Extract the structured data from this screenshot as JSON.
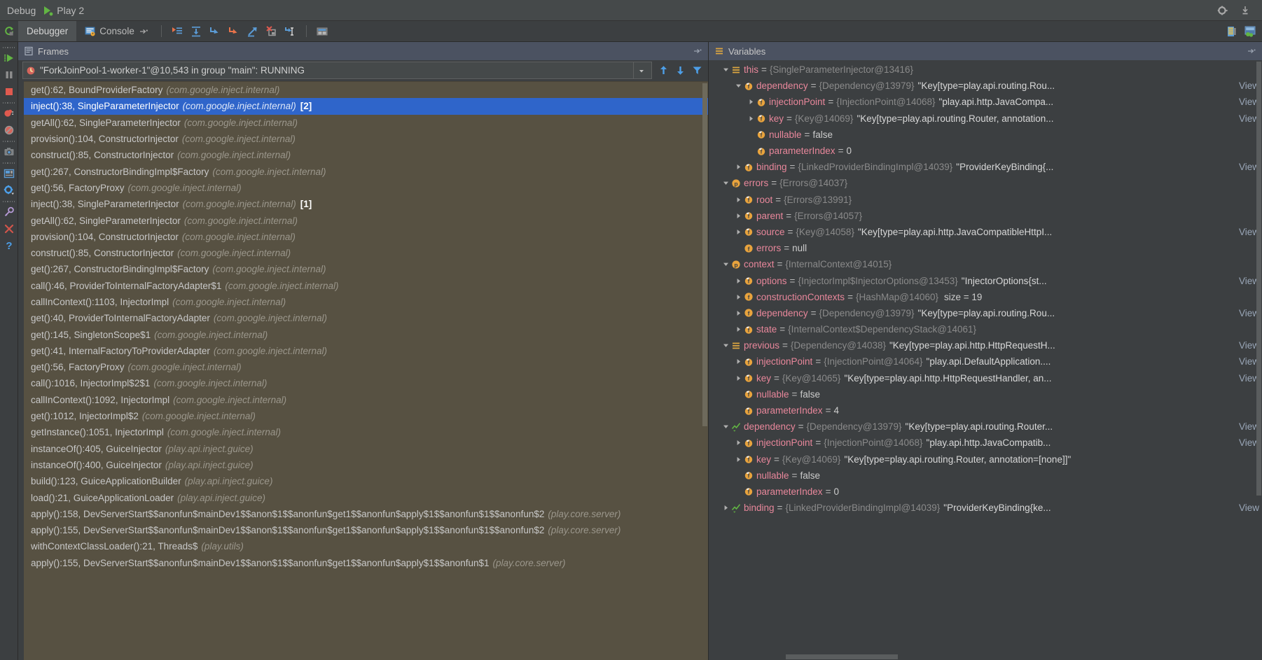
{
  "titlebar": {
    "debug_label": "Debug",
    "config_name": "Play 2",
    "settings_icon": "gear-icon",
    "minimize_icon": "minimize-icon"
  },
  "toolbar": {
    "rerun_icon": "rerun-icon",
    "tabs": [
      {
        "label": "Debugger",
        "icon": "debugger-icon",
        "active": true
      },
      {
        "label": "Console",
        "icon": "console-icon",
        "active": false
      }
    ],
    "console_pin_icon": "pin-arrow-icon",
    "buttons": [
      {
        "name": "show-execution-point",
        "icon": "execution-point-icon"
      },
      {
        "name": "step-over",
        "icon": "step-over-icon"
      },
      {
        "name": "step-into",
        "icon": "step-into-icon"
      },
      {
        "name": "force-step-into",
        "icon": "force-step-into-icon"
      },
      {
        "name": "step-out",
        "icon": "step-out-icon"
      },
      {
        "name": "drop-frame",
        "icon": "drop-frame-icon"
      },
      {
        "name": "run-to-cursor",
        "icon": "run-to-cursor-icon"
      },
      {
        "name": "evaluate-expression",
        "icon": "evaluate-expression-icon"
      }
    ],
    "right_buttons": [
      {
        "name": "threads-view",
        "icon": "threads-icon"
      },
      {
        "name": "settings-view",
        "icon": "layout-settings-icon"
      }
    ]
  },
  "rail": {
    "items": [
      {
        "name": "resume-program",
        "icon": "resume-icon"
      },
      {
        "name": "pause-program",
        "icon": "pause-icon"
      },
      {
        "name": "stop-program",
        "icon": "stop-icon"
      },
      {
        "name": "view-breakpoints",
        "icon": "breakpoints-icon"
      },
      {
        "name": "mute-breakpoints",
        "icon": "mute-breakpoints-icon"
      },
      {
        "name": "get-thread-dump",
        "icon": "camera-icon"
      },
      {
        "name": "restore-layout",
        "icon": "layout-icon"
      },
      {
        "name": "settings",
        "icon": "gear-icon"
      },
      {
        "name": "pin-tab",
        "icon": "pin-icon"
      },
      {
        "name": "close",
        "icon": "close-icon"
      },
      {
        "name": "help",
        "icon": "help-icon"
      }
    ]
  },
  "frames": {
    "panel_title": "Frames",
    "panel_icon": "frames-icon",
    "collapse_icon": "collapse-icon",
    "thread": {
      "icon": "thread-running-icon",
      "label": "\"ForkJoinPool-1-worker-1\"@10,543 in group \"main\": RUNNING",
      "dropdown_icon": "chevron-down-icon"
    },
    "tools": [
      {
        "name": "sort-frames-up",
        "icon": "arrow-up-icon"
      },
      {
        "name": "sort-frames-down",
        "icon": "arrow-down-icon"
      },
      {
        "name": "filter-frames",
        "icon": "filter-icon"
      }
    ],
    "rows": [
      {
        "method": "get():62, BoundProviderFactory",
        "pkg": "(com.google.inject.internal)",
        "count": "",
        "selected": false
      },
      {
        "method": "inject():38, SingleParameterInjector",
        "pkg": "(com.google.inject.internal)",
        "count": "[2]",
        "selected": true
      },
      {
        "method": "getAll():62, SingleParameterInjector",
        "pkg": "(com.google.inject.internal)",
        "count": "",
        "selected": false
      },
      {
        "method": "provision():104, ConstructorInjector",
        "pkg": "(com.google.inject.internal)",
        "count": "",
        "selected": false
      },
      {
        "method": "construct():85, ConstructorInjector",
        "pkg": "(com.google.inject.internal)",
        "count": "",
        "selected": false
      },
      {
        "method": "get():267, ConstructorBindingImpl$Factory",
        "pkg": "(com.google.inject.internal)",
        "count": "",
        "selected": false
      },
      {
        "method": "get():56, FactoryProxy",
        "pkg": "(com.google.inject.internal)",
        "count": "",
        "selected": false
      },
      {
        "method": "inject():38, SingleParameterInjector",
        "pkg": "(com.google.inject.internal)",
        "count": "[1]",
        "selected": false
      },
      {
        "method": "getAll():62, SingleParameterInjector",
        "pkg": "(com.google.inject.internal)",
        "count": "",
        "selected": false
      },
      {
        "method": "provision():104, ConstructorInjector",
        "pkg": "(com.google.inject.internal)",
        "count": "",
        "selected": false
      },
      {
        "method": "construct():85, ConstructorInjector",
        "pkg": "(com.google.inject.internal)",
        "count": "",
        "selected": false
      },
      {
        "method": "get():267, ConstructorBindingImpl$Factory",
        "pkg": "(com.google.inject.internal)",
        "count": "",
        "selected": false
      },
      {
        "method": "call():46, ProviderToInternalFactoryAdapter$1",
        "pkg": "(com.google.inject.internal)",
        "count": "",
        "selected": false
      },
      {
        "method": "callInContext():1103, InjectorImpl",
        "pkg": "(com.google.inject.internal)",
        "count": "",
        "selected": false
      },
      {
        "method": "get():40, ProviderToInternalFactoryAdapter",
        "pkg": "(com.google.inject.internal)",
        "count": "",
        "selected": false
      },
      {
        "method": "get():145, SingletonScope$1",
        "pkg": "(com.google.inject.internal)",
        "count": "",
        "selected": false
      },
      {
        "method": "get():41, InternalFactoryToProviderAdapter",
        "pkg": "(com.google.inject.internal)",
        "count": "",
        "selected": false
      },
      {
        "method": "get():56, FactoryProxy",
        "pkg": "(com.google.inject.internal)",
        "count": "",
        "selected": false
      },
      {
        "method": "call():1016, InjectorImpl$2$1",
        "pkg": "(com.google.inject.internal)",
        "count": "",
        "selected": false
      },
      {
        "method": "callInContext():1092, InjectorImpl",
        "pkg": "(com.google.inject.internal)",
        "count": "",
        "selected": false
      },
      {
        "method": "get():1012, InjectorImpl$2",
        "pkg": "(com.google.inject.internal)",
        "count": "",
        "selected": false
      },
      {
        "method": "getInstance():1051, InjectorImpl",
        "pkg": "(com.google.inject.internal)",
        "count": "",
        "selected": false
      },
      {
        "method": "instanceOf():405, GuiceInjector",
        "pkg": "(play.api.inject.guice)",
        "count": "",
        "selected": false
      },
      {
        "method": "instanceOf():400, GuiceInjector",
        "pkg": "(play.api.inject.guice)",
        "count": "",
        "selected": false
      },
      {
        "method": "build():123, GuiceApplicationBuilder",
        "pkg": "(play.api.inject.guice)",
        "count": "",
        "selected": false
      },
      {
        "method": "load():21, GuiceApplicationLoader",
        "pkg": "(play.api.inject.guice)",
        "count": "",
        "selected": false
      },
      {
        "method": "apply():158, DevServerStart$$anonfun$mainDev1$$anon$1$$anonfun$get1$$anonfun$apply$1$$anonfun$1$$anonfun$2",
        "pkg": "(play.core.server)",
        "count": "",
        "selected": false
      },
      {
        "method": "apply():155, DevServerStart$$anonfun$mainDev1$$anon$1$$anonfun$get1$$anonfun$apply$1$$anonfun$1$$anonfun$2",
        "pkg": "(play.core.server)",
        "count": "",
        "selected": false
      },
      {
        "method": "withContextClassLoader():21, Threads$",
        "pkg": "(play.utils)",
        "count": "",
        "selected": false
      },
      {
        "method": "apply():155, DevServerStart$$anonfun$mainDev1$$anon$1$$anonfun$get1$$anonfun$apply$1$$anonfun$1",
        "pkg": "(play.core.server)",
        "count": "",
        "selected": false
      }
    ]
  },
  "variables": {
    "panel_title": "Variables",
    "panel_icon": "variables-icon",
    "collapse_icon": "collapse-icon",
    "view_label": "View",
    "rows": [
      {
        "indent": 0,
        "twisty": "down",
        "icon": "field-group-icon",
        "name": "this",
        "type": "{SingleParameterInjector@13416}",
        "value": "",
        "view": false
      },
      {
        "indent": 1,
        "twisty": "down",
        "icon": "field-icon",
        "name": "dependency",
        "type": "{Dependency@13979}",
        "value": "\"Key[type=play.api.routing.Rou...",
        "view": true
      },
      {
        "indent": 2,
        "twisty": "right",
        "icon": "field-icon",
        "name": "injectionPoint",
        "type": "{InjectionPoint@14068}",
        "value": "\"play.api.http.JavaCompa...",
        "view": true
      },
      {
        "indent": 2,
        "twisty": "right",
        "icon": "field-icon",
        "name": "key",
        "type": "{Key@14069}",
        "value": "\"Key[type=play.api.routing.Router, annotation...",
        "view": true
      },
      {
        "indent": 2,
        "twisty": "none",
        "icon": "field-icon",
        "name": "nullable",
        "type": "",
        "value": "false",
        "view": false
      },
      {
        "indent": 2,
        "twisty": "none",
        "icon": "field-icon",
        "name": "parameterIndex",
        "type": "",
        "value": "0",
        "view": false
      },
      {
        "indent": 1,
        "twisty": "right",
        "icon": "field-icon",
        "name": "binding",
        "type": "{LinkedProviderBindingImpl@14039}",
        "value": "\"ProviderKeyBinding{...",
        "view": true
      },
      {
        "indent": 0,
        "twisty": "down",
        "icon": "param-icon",
        "name": "errors",
        "type": "{Errors@14037}",
        "value": "",
        "view": false
      },
      {
        "indent": 1,
        "twisty": "right",
        "icon": "field-icon",
        "name": "root",
        "type": "{Errors@13991}",
        "value": "",
        "view": false
      },
      {
        "indent": 1,
        "twisty": "right",
        "icon": "field-icon",
        "name": "parent",
        "type": "{Errors@14057}",
        "value": "",
        "view": false
      },
      {
        "indent": 1,
        "twisty": "right",
        "icon": "field-icon",
        "name": "source",
        "type": "{Key@14058}",
        "value": "\"Key[type=play.api.http.JavaCompatibleHttpI...",
        "view": true
      },
      {
        "indent": 1,
        "twisty": "none",
        "icon": "field-orange-icon",
        "name": "errors",
        "type": "",
        "value": "null",
        "view": false
      },
      {
        "indent": 0,
        "twisty": "down",
        "icon": "param-icon",
        "name": "context",
        "type": "{InternalContext@14015}",
        "value": "",
        "view": false
      },
      {
        "indent": 1,
        "twisty": "right",
        "icon": "field-icon",
        "name": "options",
        "type": "{InjectorImpl$InjectorOptions@13453}",
        "value": "\"InjectorOptions{st...",
        "view": true
      },
      {
        "indent": 1,
        "twisty": "right",
        "icon": "field-orange-icon",
        "name": "constructionContexts",
        "type": "{HashMap@14060}",
        "value": "",
        "size": "size = 19",
        "view": false
      },
      {
        "indent": 1,
        "twisty": "right",
        "icon": "field-orange-icon",
        "name": "dependency",
        "type": "{Dependency@13979}",
        "value": "\"Key[type=play.api.routing.Rou...",
        "view": true
      },
      {
        "indent": 1,
        "twisty": "right",
        "icon": "field-icon",
        "name": "state",
        "type": "{InternalContext$DependencyStack@14061}",
        "value": "",
        "view": false
      },
      {
        "indent": 0,
        "twisty": "down",
        "icon": "field-group-icon",
        "name": "previous",
        "type": "{Dependency@14038}",
        "value": "\"Key[type=play.api.http.HttpRequestH...",
        "view": true
      },
      {
        "indent": 1,
        "twisty": "right",
        "icon": "field-icon",
        "name": "injectionPoint",
        "type": "{InjectionPoint@14064}",
        "value": "\"play.api.DefaultApplication....",
        "view": true
      },
      {
        "indent": 1,
        "twisty": "right",
        "icon": "field-icon",
        "name": "key",
        "type": "{Key@14065}",
        "value": "\"Key[type=play.api.http.HttpRequestHandler, an...",
        "view": true
      },
      {
        "indent": 1,
        "twisty": "none",
        "icon": "field-icon",
        "name": "nullable",
        "type": "",
        "value": "false",
        "view": false
      },
      {
        "indent": 1,
        "twisty": "none",
        "icon": "field-icon",
        "name": "parameterIndex",
        "type": "",
        "value": "4",
        "view": false
      },
      {
        "indent": 0,
        "twisty": "down",
        "icon": "watch-icon",
        "name": "dependency",
        "type": "{Dependency@13979}",
        "value": "\"Key[type=play.api.routing.Router...",
        "view": true
      },
      {
        "indent": 1,
        "twisty": "right",
        "icon": "field-icon",
        "name": "injectionPoint",
        "type": "{InjectionPoint@14068}",
        "value": "\"play.api.http.JavaCompatib...",
        "view": true
      },
      {
        "indent": 1,
        "twisty": "right",
        "icon": "field-icon",
        "name": "key",
        "type": "{Key@14069}",
        "value": "\"Key[type=play.api.routing.Router, annotation=[none]]\"",
        "view": false
      },
      {
        "indent": 1,
        "twisty": "none",
        "icon": "field-icon",
        "name": "nullable",
        "type": "",
        "value": "false",
        "view": false
      },
      {
        "indent": 1,
        "twisty": "none",
        "icon": "field-icon",
        "name": "parameterIndex",
        "type": "",
        "value": "0",
        "view": false
      },
      {
        "indent": 0,
        "twisty": "right",
        "icon": "watch-icon",
        "name": "binding",
        "type": "{LinkedProviderBindingImpl@14039}",
        "value": "\"ProviderKeyBinding{ke...",
        "view": true
      }
    ]
  },
  "colors": {
    "background": "#3c3f41",
    "titlebar": "#45494a",
    "pane_header": "#4b5261",
    "frames_bg": "#575142",
    "selection": "#2f65ca",
    "var_name": "#e8879b",
    "type_text": "#8a8a8a",
    "accent_blue": "#4d9fe8"
  }
}
